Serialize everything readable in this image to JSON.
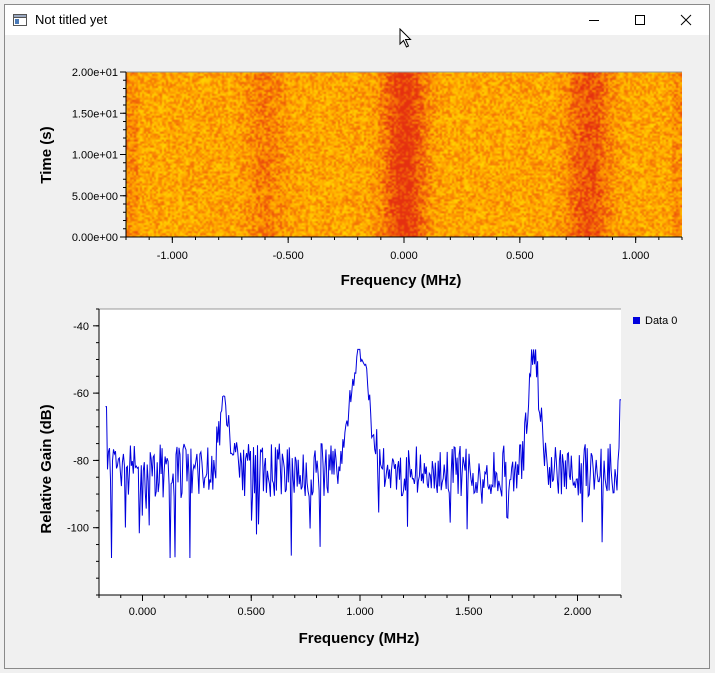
{
  "window": {
    "title": "Not titled yet",
    "minimize_icon": "minimize-icon",
    "maximize_icon": "maximize-icon",
    "close_icon": "close-icon"
  },
  "colors": {
    "series": "#0000dd",
    "waterfall_low": "#fff200",
    "waterfall_mid": "#ffa000",
    "waterfall_high": "#e53010"
  },
  "chart_data": [
    {
      "type": "heatmap",
      "xlabel": "Frequency (MHz)",
      "ylabel": "Time (s)",
      "xlim": [
        -1.2,
        1.2
      ],
      "ylim": [
        0,
        20
      ],
      "x_ticks": [
        "-1.000",
        "-0.500",
        "0.000",
        "0.500",
        "1.000"
      ],
      "y_ticks": [
        "0.00e+00",
        "5.00e+00",
        "1.00e+01",
        "1.50e+01",
        "2.00e+01"
      ],
      "bands": [
        {
          "center_mhz": -0.6,
          "intensity": 0.35
        },
        {
          "center_mhz": 0.0,
          "intensity": 1.0
        },
        {
          "center_mhz": 0.8,
          "intensity": 0.75
        }
      ]
    },
    {
      "type": "line",
      "xlabel": "Frequency (MHz)",
      "ylabel": "Relative Gain (dB)",
      "xlim": [
        -0.2,
        2.2
      ],
      "ylim": [
        -120,
        -35
      ],
      "x_ticks": [
        "0.000",
        "0.500",
        "1.000",
        "1.500",
        "2.000"
      ],
      "y_ticks": [
        "-40",
        "-60",
        "-80",
        "-100"
      ],
      "legend": "top-right",
      "series": [
        {
          "name": "Data 0",
          "peaks": [
            {
              "x": 0.38,
              "y": -62
            },
            {
              "x": 1.0,
              "y": -48
            },
            {
              "x": 1.8,
              "y": -47
            }
          ],
          "noise_floor_db": -83,
          "min_db": -109
        }
      ]
    }
  ]
}
